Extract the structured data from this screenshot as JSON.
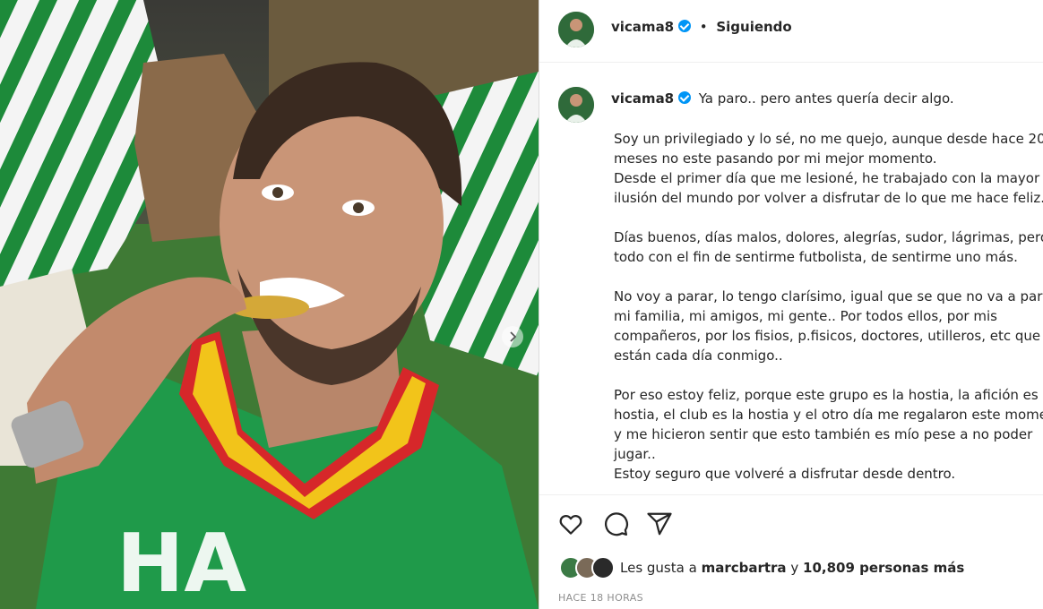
{
  "post": {
    "username": "vicama8",
    "follow_label": "Siguiendo",
    "separator": "•",
    "caption_first_line": "Ya paro.. pero antes quería decir algo.",
    "caption_body": "Soy un privilegiado y lo sé, no me quejo, aunque desde hace 20\nmeses no este pasando por mi mejor momento.\nDesde el primer día que me lesioné, he trabajado con la mayor\nilusión del mundo por volver a disfrutar de lo que me hace feliz.\n\nDías buenos, días malos, dolores, alegrías, sudor, lágrimas, pero\ntodo con el fin de sentirme futbolista, de sentirme uno más.\n\nNo voy a parar, lo tengo clarísimo, igual que se que no va a parar\nmi familia, mi amigos, mi gente.. Por todos ellos, por mis\ncompañeros, por los fisios, p.fisicos, doctores, utilleros, etc que\nestán cada día conmigo..\n\nPor eso estoy feliz, porque este grupo es la hostia, la afición es la\nhostia, el club es la hostia y el otro día me regalaron este momento\ny me hicieron sentir que esto también es mío pese a no poder\njugar..\nEstoy seguro que volveré a disfrutar desde dentro.",
    "likes_prefix": "Les gusta a",
    "likes_user": "marcbartra",
    "likes_connector": "y",
    "likes_count_text": "10,809 personas más",
    "timestamp": "HACE 18 HORAS"
  },
  "icons": {
    "verified": "verified-badge-icon",
    "like": "heart-icon",
    "comment": "comment-bubble-icon",
    "share": "paper-plane-icon",
    "carousel": "chevron-right-icon"
  },
  "colors": {
    "verified": "#0095f6",
    "text": "#262626",
    "muted": "#8e8e8e",
    "divider": "#efefef",
    "betis_green": "#1f8a3c"
  }
}
